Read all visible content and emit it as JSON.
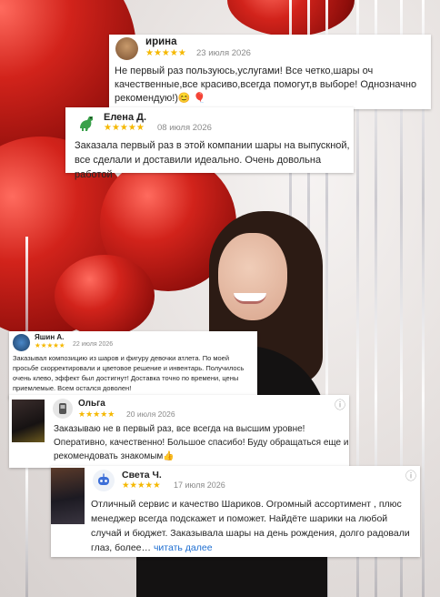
{
  "reviews": [
    {
      "name": "ирина",
      "stars": "★★★★★",
      "date": "23 июля 2026",
      "text": "Не первый раз пользуюсь,услугами! Все четко,шары оч качественные,все красиво,всегда помогут,в выборе! Однозначно рекомендую!)😊 🎈"
    },
    {
      "name": "Елена Д.",
      "stars": "★★★★★",
      "date": "08 июля 2026",
      "text": "Заказала первый раз в этой компании шары на выпускной, все сделали и доставили идеально. Очень довольна работой"
    },
    {
      "name": "Яшин А.",
      "stars": "★★★★★",
      "date": "22 июля 2026",
      "text": "Заказывал композицию из шаров и фигуру девочки атлета. По моей просьбе скорректировали и цветовое решение и инвентарь. Получилось очень клево, эффект был достигнут! Доставка точно по времени, цены приемлемые. Всем остался доволен!"
    },
    {
      "name": "Ольга",
      "stars": "★★★★★",
      "date": "20 июля 2026",
      "text": "Заказываю не в первый раз, все всегда на высшим уровне! Оперативно, качественно! Большое спасибо! Буду обращаться еще и рекомендовать знакомым👍"
    },
    {
      "name": "Света Ч.",
      "stars": "★★★★★",
      "date": "17 июля 2026",
      "text": "Отличный сервис и качество Шариков. Огромный ассортимент , плюс менеджер всегда подскажет и поможет. Найдёте шарики на любой случай и бюджет. Заказывала шары на день рождения, долго радовали глаз, более…",
      "read_more": "читать далее"
    }
  ],
  "icons": {
    "more": "more-options-icon",
    "info": "ⓘ"
  },
  "colors": {
    "star": "#f5b800",
    "link": "#1f6fd1",
    "balloon": "#d2231b"
  }
}
